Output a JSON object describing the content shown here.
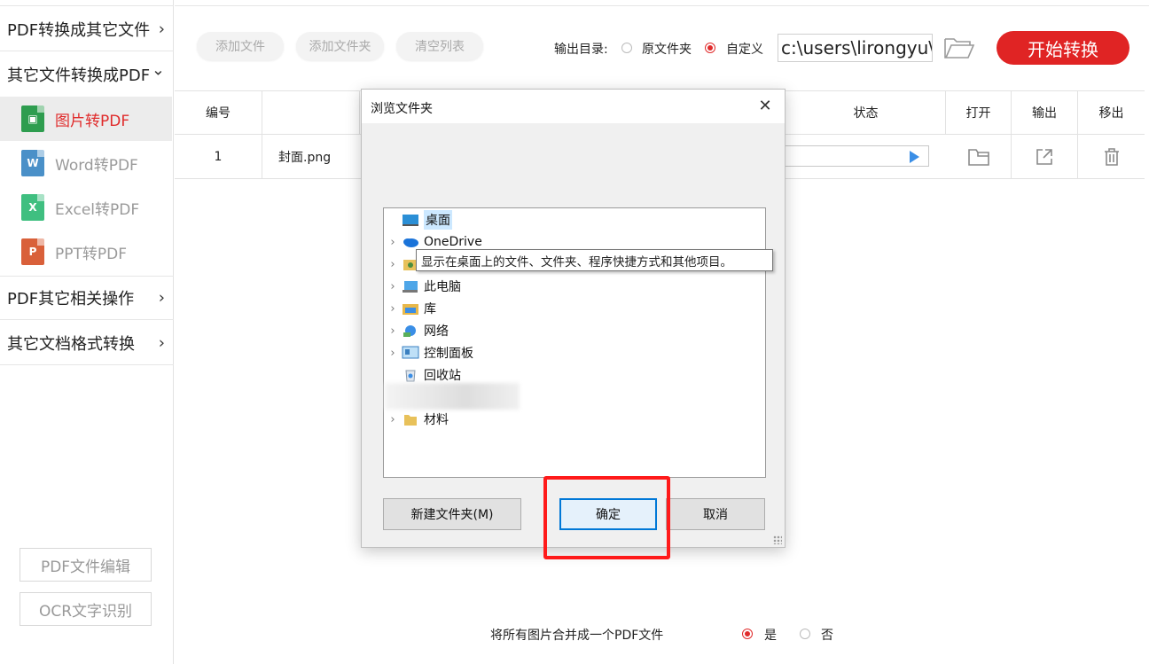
{
  "sidebar": {
    "sections": [
      {
        "label": "PDF转换成其它文件",
        "chevron": "›"
      },
      {
        "label": "其它文件转换成PDF",
        "chevron": "⌄"
      },
      {
        "label": "PDF其它相关操作",
        "chevron": "›"
      },
      {
        "label": "其它文档格式转换",
        "chevron": "›"
      }
    ],
    "items": [
      {
        "label": "图片转PDF",
        "icon": "image-file-icon",
        "color": "#2e9d4f",
        "glyph": "▣"
      },
      {
        "label": "Word转PDF",
        "icon": "word-file-icon",
        "color": "#4a90c8",
        "glyph": "W"
      },
      {
        "label": "Excel转PDF",
        "icon": "excel-file-icon",
        "color": "#3fbf80",
        "glyph": "X"
      },
      {
        "label": "PPT转PDF",
        "icon": "ppt-file-icon",
        "color": "#d9603a",
        "glyph": "P"
      }
    ],
    "bottom_buttons": [
      "PDF文件编辑",
      "OCR文字识别"
    ]
  },
  "toolbar": {
    "add_file": "添加文件",
    "add_folder": "添加文件夹",
    "clear_list": "清空列表",
    "output_dir_label": "输出目录:",
    "option_original": "原文件夹",
    "option_custom": "自定义",
    "output_path": "c:\\users\\lirongyu\\",
    "start": "开始转换"
  },
  "table": {
    "headers": {
      "index": "编号",
      "status": "状态",
      "open": "打开",
      "output": "输出",
      "remove": "移出"
    },
    "rows": [
      {
        "index": "1",
        "filename": "封面.png"
      }
    ]
  },
  "merge": {
    "label": "将所有图片合并成一个PDF文件",
    "yes": "是",
    "no": "否"
  },
  "dialog": {
    "title": "浏览文件夹",
    "close": "✕",
    "tree": [
      {
        "label": "桌面",
        "icon": "desktop-icon",
        "expander": ""
      },
      {
        "label": "OneDrive",
        "icon": "onedrive-cloud-icon",
        "expander": "›"
      },
      {
        "label": "",
        "icon": "user-folder-icon",
        "expander": "›"
      },
      {
        "label": "此电脑",
        "icon": "computer-icon",
        "expander": "›"
      },
      {
        "label": "库",
        "icon": "library-icon",
        "expander": "›"
      },
      {
        "label": "网络",
        "icon": "network-icon",
        "expander": "›"
      },
      {
        "label": "控制面板",
        "icon": "control-panel-icon",
        "expander": "›"
      },
      {
        "label": "回收站",
        "icon": "recycle-bin-icon",
        "expander": ""
      },
      {
        "label": "",
        "icon": "blurred-folder-icon",
        "expander": ""
      },
      {
        "label": "材料",
        "icon": "folder-icon",
        "expander": "›"
      }
    ],
    "tooltip": "显示在桌面上的文件、文件夹、程序快捷方式和其他项目。",
    "new_folder": "新建文件夹(M)",
    "ok": "确定",
    "cancel": "取消"
  },
  "colors": {
    "accent": "#e02424",
    "selection": "#cce8ff",
    "focus": "#0078d7",
    "annotation": "#ff1a1a"
  }
}
